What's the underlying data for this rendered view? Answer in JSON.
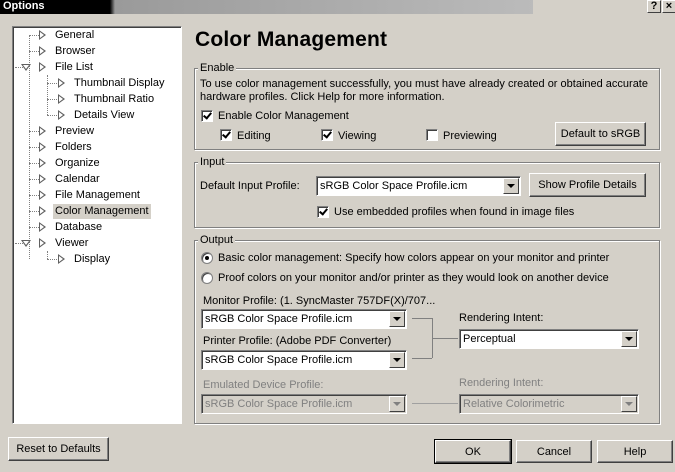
{
  "window": {
    "title": "Options",
    "help_glyph": "?",
    "close_glyph": "×"
  },
  "tree": {
    "items": [
      {
        "label": "General"
      },
      {
        "label": "Browser"
      },
      {
        "label": "File List"
      },
      {
        "label": "Thumbnail Display"
      },
      {
        "label": "Thumbnail Ratio"
      },
      {
        "label": "Details View"
      },
      {
        "label": "Preview"
      },
      {
        "label": "Folders"
      },
      {
        "label": "Organize"
      },
      {
        "label": "Calendar"
      },
      {
        "label": "File Management"
      },
      {
        "label": "Color Management"
      },
      {
        "label": "Database"
      },
      {
        "label": "Viewer"
      },
      {
        "label": "Display"
      }
    ],
    "selected": "Color Management"
  },
  "page": {
    "heading": "Color Management"
  },
  "enable": {
    "legend": "Enable",
    "description_line1": "To use color management successfully, you must have already created or obtained accurate",
    "description_line2": "hardware profiles. Click Help for more information.",
    "enable_cm_label": "Enable Color Management",
    "enable_cm_checked": true,
    "editing_label": "Editing",
    "editing_checked": true,
    "viewing_label": "Viewing",
    "viewing_checked": true,
    "previewing_label": "Previewing",
    "previewing_checked": false,
    "default_srgb_button": "Default to sRGB"
  },
  "input": {
    "legend": "Input",
    "default_profile_label": "Default Input Profile:",
    "default_profile_value": "sRGB Color Space Profile.icm",
    "show_details_button": "Show Profile Details",
    "embedded_label": "Use embedded profiles when found in image files",
    "embedded_checked": true
  },
  "output": {
    "legend": "Output",
    "basic_radio_label": "Basic color management: Specify how colors appear on your monitor and printer",
    "proof_radio_label": "Proof colors on your monitor and/or printer as they would look on another device",
    "selected_radio": "basic",
    "monitor_profile_label": "Monitor Profile: (1.  SyncMaster 757DF(X)/707...",
    "monitor_profile_value": "sRGB Color Space Profile.icm",
    "printer_profile_label": "Printer Profile: (Adobe PDF Converter)",
    "printer_profile_value": "sRGB Color Space Profile.icm",
    "rendering_intent_label": "Rendering Intent:",
    "rendering_intent_value": "Perceptual",
    "emulated_label": "Emulated Device Profile:",
    "emulated_value": "sRGB Color Space Profile.icm",
    "emulated_intent_label": "Rendering Intent:",
    "emulated_intent_value": "Relative Colorimetric"
  },
  "footer": {
    "reset_button": "Reset to Defaults",
    "ok_button": "OK",
    "cancel_button": "Cancel",
    "help_button": "Help"
  }
}
